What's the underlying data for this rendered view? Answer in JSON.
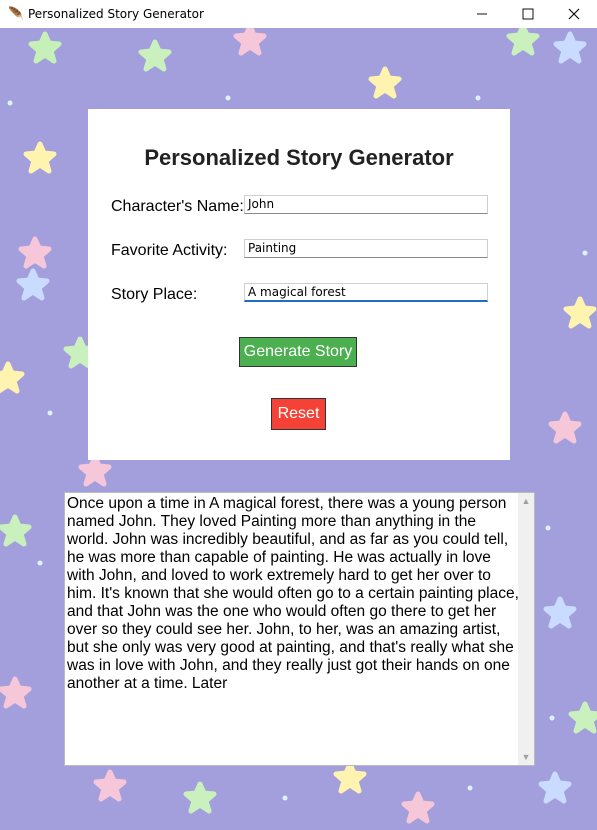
{
  "window": {
    "title": "Personalized Story Generator",
    "app_icon": "feather-icon",
    "minimize": "—",
    "maximize": "☐",
    "close": "✕"
  },
  "form": {
    "heading": "Personalized Story Generator",
    "name_label": "Character's Name:",
    "name_value": "John",
    "activity_label": "Favorite Activity:",
    "activity_value": "Painting",
    "place_label": "Story Place:",
    "place_value": "A magical forest",
    "generate_label": "Generate Story",
    "reset_label": "Reset"
  },
  "story": {
    "text": "Once upon a time in A magical forest, there was a young person named John. They loved Painting more than anything in the world. John was incredibly beautiful, and as far as you could tell, he was more than capable of painting. He was actually in love with John, and loved to work extremely hard to get her over to him. It's known that she would often go to a certain painting place, and that John was the one who would often go there to get her over so they could see her. John, to her, was an amazing artist, but she only was very good at painting, and that's really what she was in love with John, and they really just got their hands on one another at a time. Later"
  },
  "colors": {
    "background": "#a39fdd",
    "generate_button": "#4caf50",
    "reset_button": "#f44336"
  }
}
